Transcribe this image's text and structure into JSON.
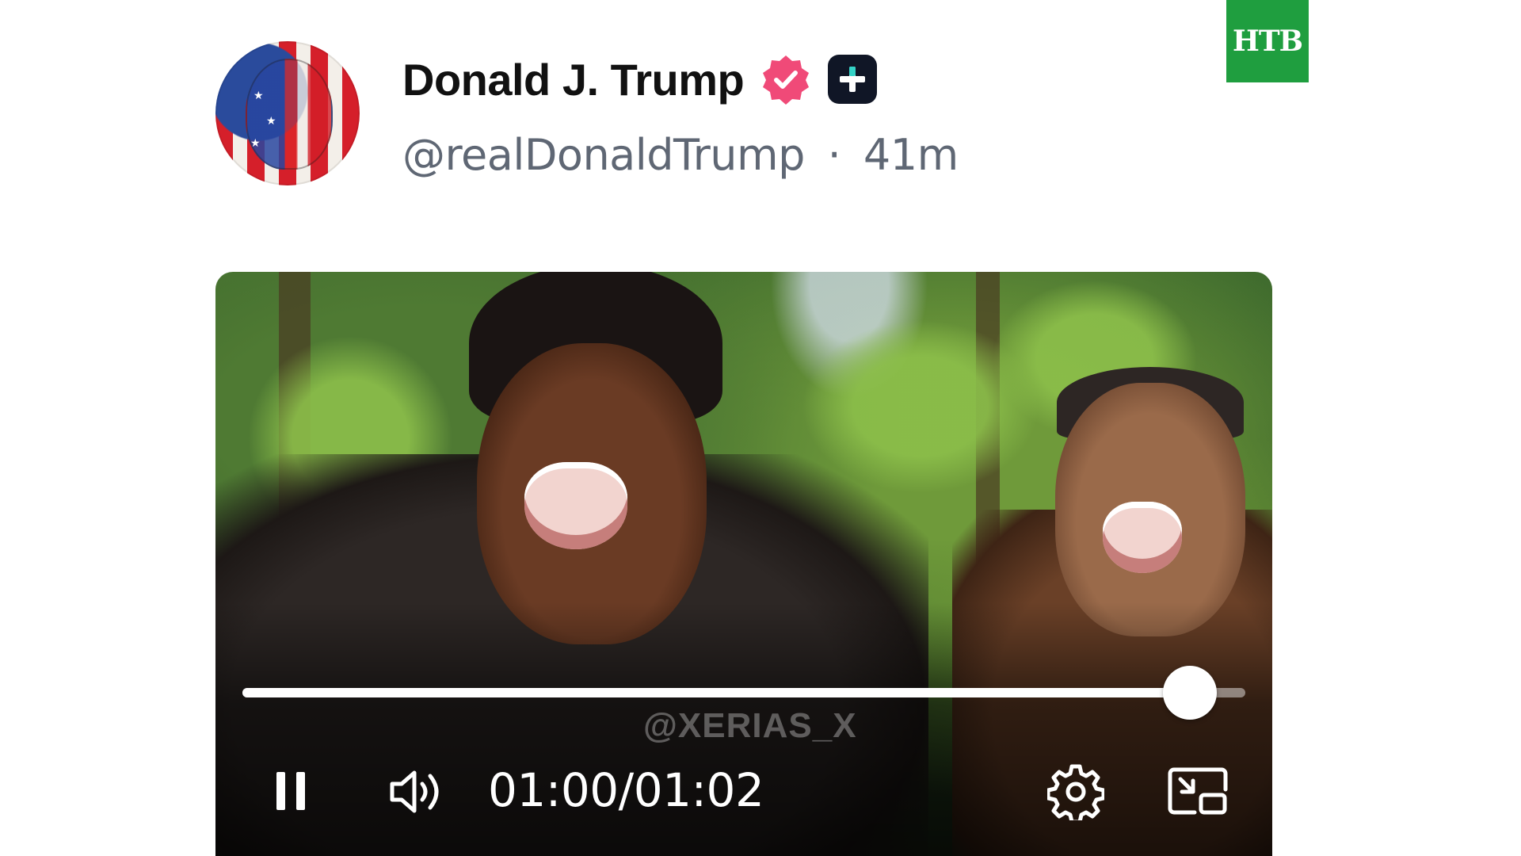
{
  "channel_logo": {
    "text": "НТВ",
    "color": "#1f9e3f"
  },
  "post": {
    "author": {
      "display_name": "Donald J. Trump",
      "handle": "@realDonaldTrump",
      "separator": "·",
      "time_ago": "41m",
      "verified_badge_color": "#f04a78",
      "extra_badge_icon": "plus-badge-icon"
    }
  },
  "video": {
    "watermark": "@XERIAS_X",
    "progress_fraction": 0.945,
    "time_current": "01:00",
    "time_separator": "/",
    "time_total": "01:02",
    "controls": {
      "play_state_icon": "pause-icon",
      "volume_icon": "volume-icon",
      "settings_icon": "gear-icon",
      "pip_icon": "picture-in-picture-icon"
    }
  }
}
